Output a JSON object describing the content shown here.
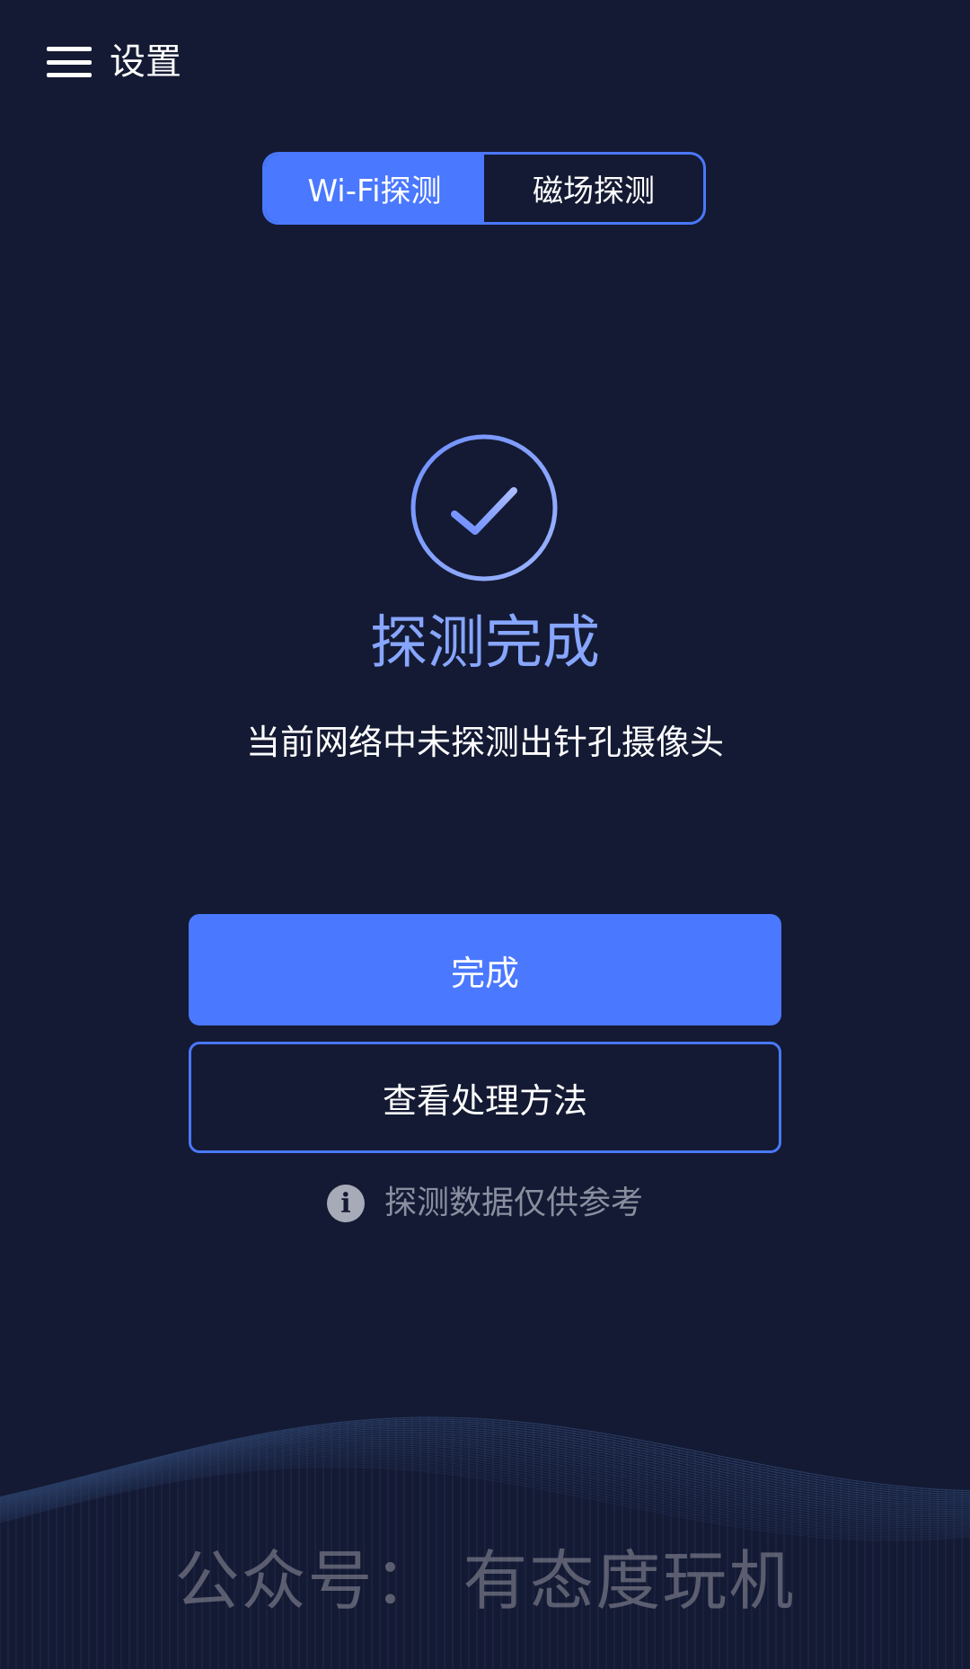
{
  "header": {
    "menu_icon": "hamburger-menu-icon",
    "title": "设置"
  },
  "tabs": [
    {
      "label": "Wi-Fi探测",
      "active": true
    },
    {
      "label": "磁场探测",
      "active": false
    }
  ],
  "result": {
    "icon": "check-circle-icon",
    "title": "探测完成",
    "description": "当前网络中未探测出针孔摄像头"
  },
  "buttons": {
    "primary_label": "完成",
    "secondary_label": "查看处理方法"
  },
  "note": {
    "icon": "info-icon",
    "text": "探测数据仅供参考"
  },
  "watermark": "公众号：  有态度玩机",
  "colors": {
    "background": "#141a33",
    "accent": "#4a78ff",
    "result_title": "#87a6ff"
  }
}
